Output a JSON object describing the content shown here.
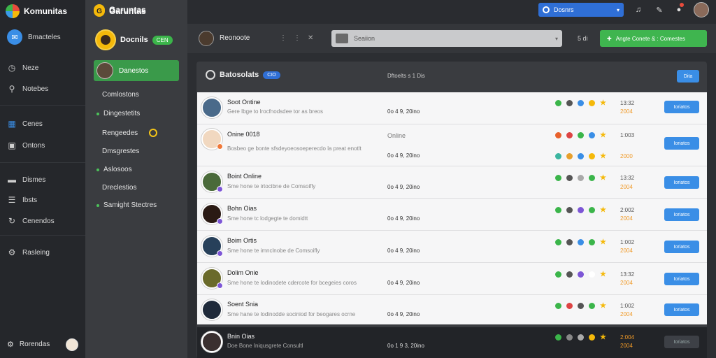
{
  "app": {
    "brand": "Komunitas"
  },
  "rail": {
    "items": [
      {
        "label": "Bmacteles",
        "icon": "home-icon"
      },
      {
        "label": "Neze",
        "icon": "clock-icon"
      },
      {
        "label": "Notebes",
        "icon": "wrench-icon"
      },
      {
        "label": "Cenes",
        "icon": "grid-icon"
      },
      {
        "label": "Ontons",
        "icon": "inbox-icon"
      },
      {
        "label": "Dismes",
        "icon": "folder-icon"
      },
      {
        "label": "Ibsts",
        "icon": "list-icon"
      },
      {
        "label": "Cenendos",
        "icon": "refresh-icon"
      },
      {
        "label": "Rasleing",
        "icon": "gear-icon"
      }
    ],
    "user_label": "Rorendas"
  },
  "col2": {
    "header": "Garuntas",
    "server_name": "Docnils",
    "server_badge": "CEN",
    "active_channel": "Danestos",
    "channels": [
      "Comlostons",
      "Dingestetits",
      "Rengeedes",
      "Dmsgrestes",
      "Aslosoos",
      "Dreclestios",
      "Samight Stectres"
    ]
  },
  "top": {
    "search_label": "Dosnrs"
  },
  "subbar": {
    "title": "Reonoote",
    "dropdown_label": "Seaiion",
    "count": "5 di",
    "cta_label": "Angte Conete & : Comestes"
  },
  "panel": {
    "title": "Batosolats",
    "pill": "CIO",
    "meta": "Dftoelts s 1 Dis",
    "button": "Dita"
  },
  "rows": [
    {
      "name": "Soot Ontine",
      "desc": "Gere Ibge to lrocfnodsdee tor as breos",
      "time": "0o 4 9, 20ino",
      "n1": "13:32",
      "n2": "2004",
      "btn": "Ioriatos"
    },
    {
      "name": "Onine 0018",
      "desc": "Bosbeo ge bonte sfsdeyoeosoeperecdo la preat enotlt",
      "status": "Online",
      "time": "0o 4 9, 20ino",
      "n1": "1:003",
      "n2": "2000",
      "btn": "Ioriatos"
    },
    {
      "name": "Boint Online",
      "desc": "Sme hone te irtocibne de Comsoifly",
      "time": "0o 4 9, 20ino",
      "n1": "13:32",
      "n2": "2004",
      "btn": "Ioriatos"
    },
    {
      "name": "Bohn Oias",
      "desc": "Sme hone tc lodgegte te domidtt",
      "time": "0o 4 9, 20ino",
      "n1": "2:002",
      "n2": "2004",
      "btn": "Ioriatos"
    },
    {
      "name": "Boim Ortis",
      "desc": "Sme hone te imnclnobe de Comsoifly",
      "time": "0o 4 9, 20ino",
      "n1": "1:002",
      "n2": "2004",
      "btn": "Ioriatos"
    },
    {
      "name": "Dolim Onie",
      "desc": "Sme hone te lodinodete cdercote for bcegeies coros",
      "time": "0o 4 9, 20ino",
      "n1": "13:32",
      "n2": "2004",
      "btn": "Ioriatos"
    },
    {
      "name": "Soent Snia",
      "desc": "Sme hane te lodinodde sociniod for beogares ocrne",
      "time": "0o 4 9, 20ino",
      "n1": "1:002",
      "n2": "2004",
      "btn": "Ioriatos"
    },
    {
      "name": "Bnin Oias",
      "desc": "Doe Bone Iniqusgrete Consultl",
      "time": "0o 1 9 3, 20ino",
      "n1": "2:004",
      "n2": "2004",
      "btn": "Ioriatos"
    }
  ],
  "colors": {
    "accent": "#3a8ee6",
    "green": "#3fb54f",
    "rail": "#25272b"
  }
}
